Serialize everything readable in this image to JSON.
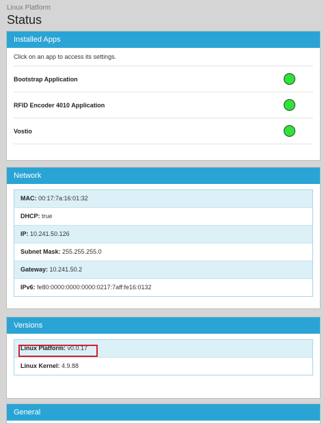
{
  "header": {
    "breadcrumb": "Linux Platform",
    "title": "Status"
  },
  "installed_apps": {
    "heading": "Installed Apps",
    "intro": "Click on an app to access its settings.",
    "apps": [
      {
        "name": "Bootstrap Application",
        "status_color": "#33e13c"
      },
      {
        "name": "RFID Encoder 4010 Application",
        "status_color": "#33e13c"
      },
      {
        "name": "Vostio",
        "status_color": "#33e13c"
      }
    ]
  },
  "network": {
    "heading": "Network",
    "rows": [
      {
        "label": "MAC:",
        "value": "00:17:7a:16:01:32"
      },
      {
        "label": "DHCP:",
        "value": "true"
      },
      {
        "label": "IP:",
        "value": "10.241.50.126"
      },
      {
        "label": "Subnet Mask:",
        "value": "255.255.255.0"
      },
      {
        "label": "Gateway:",
        "value": "10.241.50.2"
      },
      {
        "label": "IPv6:",
        "value": "fe80:0000:0000:0000:0217:7aff:fe16:0132"
      }
    ]
  },
  "versions": {
    "heading": "Versions",
    "rows": [
      {
        "label": "Linux Platform:",
        "value": "v0.0.17"
      },
      {
        "label": "Linux Kernel:",
        "value": "4.9.88"
      }
    ],
    "highlight_color": "#d11f2a"
  },
  "general": {
    "heading": "General"
  },
  "colors": {
    "panel_heading": "#2aa4d4",
    "row_alt": "#dcf0f8"
  }
}
